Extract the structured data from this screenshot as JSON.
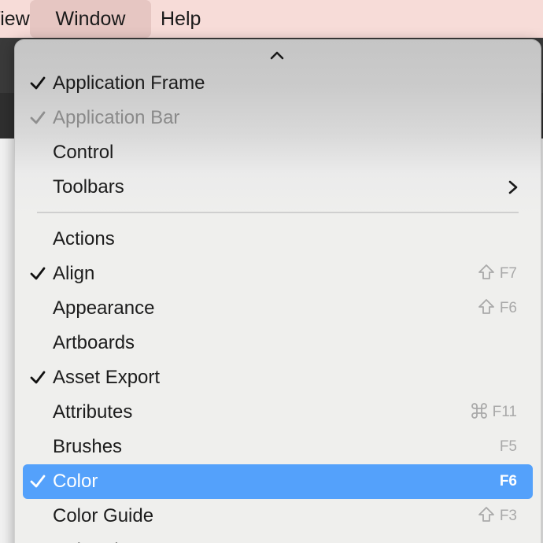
{
  "menubar": {
    "view_label": "View",
    "window_label": "Window",
    "help_label": "Help"
  },
  "menu": {
    "scroll_up_icon": "chevron-up-icon",
    "top_items": [
      {
        "label": "Application Frame",
        "checked": true,
        "disabled": false
      },
      {
        "label": "Application Bar",
        "checked": true,
        "disabled": true
      },
      {
        "label": "Control",
        "checked": false,
        "disabled": false
      },
      {
        "label": "Toolbars",
        "checked": false,
        "disabled": false,
        "submenu": true
      }
    ],
    "items": [
      {
        "label": "Actions",
        "checked": false,
        "shortcut": ""
      },
      {
        "label": "Align",
        "checked": true,
        "shortcut_mod": "shift",
        "shortcut": "F7"
      },
      {
        "label": "Appearance",
        "checked": false,
        "shortcut_mod": "shift",
        "shortcut": "F6"
      },
      {
        "label": "Artboards",
        "checked": false,
        "shortcut": ""
      },
      {
        "label": "Asset Export",
        "checked": true,
        "shortcut": ""
      },
      {
        "label": "Attributes",
        "checked": false,
        "shortcut_mod": "command",
        "shortcut": "F11"
      },
      {
        "label": "Brushes",
        "checked": false,
        "shortcut": "F5"
      },
      {
        "label": "Color",
        "checked": true,
        "shortcut": "F6",
        "selected": true
      },
      {
        "label": "Color Guide",
        "checked": false,
        "shortcut_mod": "shift",
        "shortcut": "F3"
      },
      {
        "label": "Color Themes",
        "checked": false,
        "shortcut": ""
      }
    ]
  },
  "colors": {
    "selection": "#54a1fb",
    "menubar_bg": "#f7dcd8",
    "menubar_active": "#e6c6c2"
  }
}
